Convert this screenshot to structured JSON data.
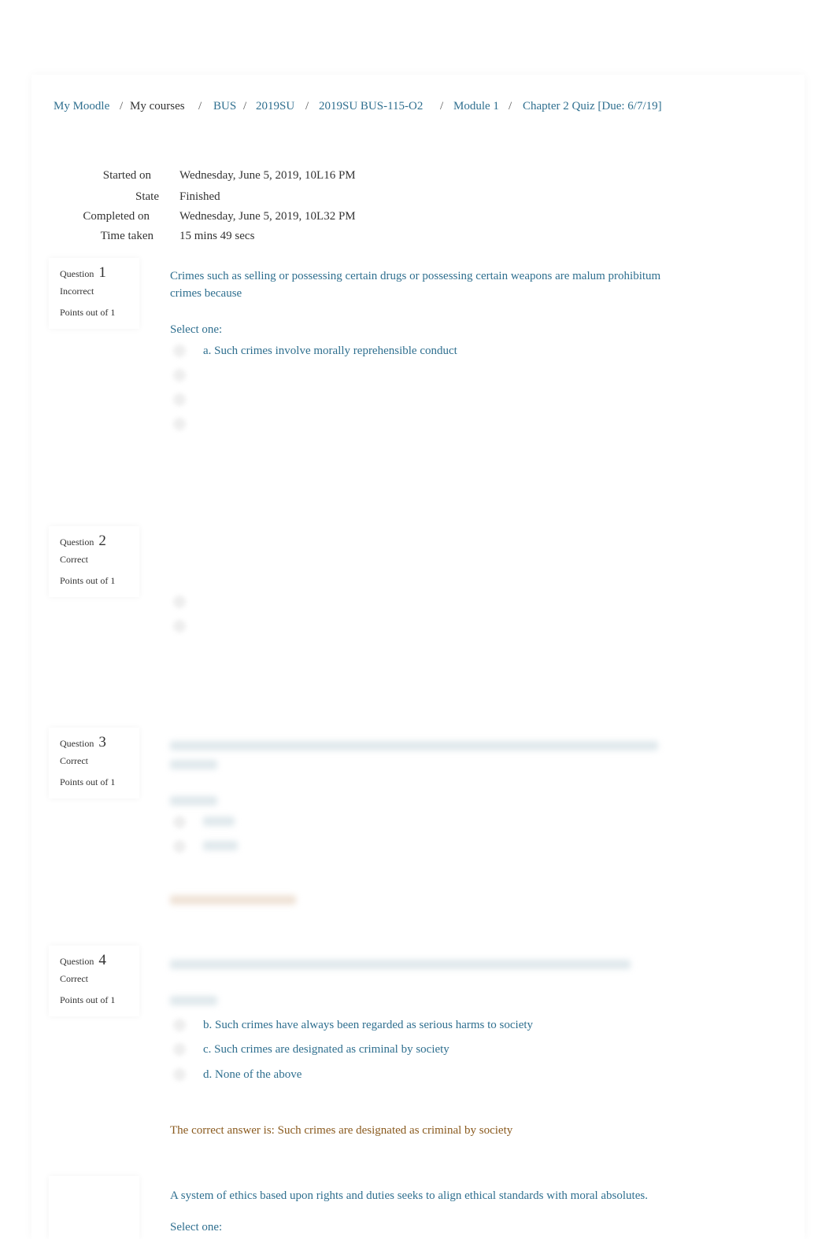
{
  "breadcrumb": [
    {
      "label": "My Moodle",
      "link": true
    },
    {
      "label": "My courses",
      "link": false
    },
    {
      "label": "BUS",
      "link": true
    },
    {
      "label": "2019SU",
      "link": true
    },
    {
      "label": "2019SU BUS-115-O2",
      "link": true
    },
    {
      "label": "Module 1",
      "link": true
    },
    {
      "label": "Chapter 2 Quiz [Due: 6/7/19]",
      "link": true
    }
  ],
  "separator": "/",
  "summary": {
    "started_label": "Started on",
    "started_value": "Wednesday, June 5, 2019, 10L16 PM",
    "state_label": "State",
    "state_value": "Finished",
    "completed_label": "Completed on",
    "completed_value": "Wednesday, June 5, 2019, 10L32 PM",
    "time_label": "Time taken",
    "time_value": "15 mins 49 secs"
  },
  "questions": [
    {
      "label": "Question",
      "number": "1",
      "status": "Incorrect",
      "points": "Points out of 1",
      "text": "Crimes such as selling or possessing certain drugs or possessing certain weapons are malum prohibitum crimes because",
      "select": "Select one:",
      "option_a": "a. Such crimes involve morally reprehensible conduct"
    },
    {
      "label": "Question",
      "number": "2",
      "status": "Correct",
      "points": "Points out of 1"
    },
    {
      "label": "Question",
      "number": "3",
      "status": "Correct",
      "points": "Points out of 1"
    },
    {
      "label": "Question",
      "number": "4",
      "status": "Correct",
      "points": "Points out of 1",
      "option_b": "b. Such crimes have always been regarded as serious harms to society",
      "option_c": "c. Such crimes are designated as criminal by society",
      "option_d": "d. None of the above",
      "feedback": "The correct answer is: Such crimes are designated as criminal by society"
    },
    {
      "text": "A system of ethics based upon rights and duties seeks to align ethical standards with moral absolutes.",
      "select": "Select one:"
    }
  ],
  "colors": {
    "link": "#2f6f8f",
    "feedback": "#8a5a1e"
  }
}
